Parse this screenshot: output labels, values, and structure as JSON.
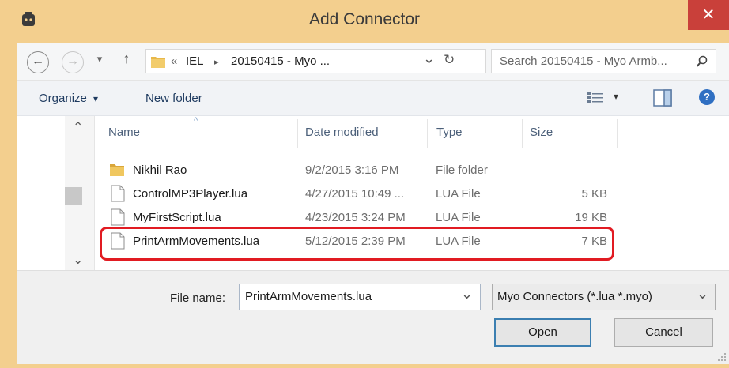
{
  "window": {
    "title": "Add Connector",
    "close_glyph": "✕"
  },
  "nav": {
    "back_glyph": "←",
    "forward_glyph": "→",
    "recent_glyph": "▾",
    "up_glyph": "↑",
    "breadcrumb_prefix": "«",
    "breadcrumb": [
      "IEL",
      "20150415 - Myo ..."
    ],
    "breadcrumb_sep": "▸",
    "dropdown_glyph": "⌄",
    "refresh_glyph": "↻",
    "search_placeholder": "Search 20150415 - Myo Armb...",
    "search_glyph": "⚲"
  },
  "toolbar": {
    "organize_label": "Organize",
    "organize_arrow": "▾",
    "new_folder_label": "New folder",
    "view_arrow": "▾",
    "help_glyph": "?"
  },
  "navpane": {
    "up_arrow": "⌃",
    "down_arrow": "⌄"
  },
  "columns": {
    "name": "Name",
    "date_modified": "Date modified",
    "type": "Type",
    "size": "Size",
    "sort_glyph": "^"
  },
  "files": [
    {
      "name": "Nikhil Rao",
      "date": "9/2/2015 3:16 PM",
      "type": "File folder",
      "size": "",
      "icon": "folder-icon"
    },
    {
      "name": "ControlMP3Player.lua",
      "date": "4/27/2015 10:49 ...",
      "type": "LUA File",
      "size": "5 KB",
      "icon": "file-icon"
    },
    {
      "name": "MyFirstScript.lua",
      "date": "4/23/2015 3:24 PM",
      "type": "LUA File",
      "size": "19 KB",
      "icon": "file-icon"
    },
    {
      "name": "PrintArmMovements.lua",
      "date": "5/12/2015 2:39 PM",
      "type": "LUA File",
      "size": "7 KB",
      "icon": "file-icon"
    }
  ],
  "bottom": {
    "filename_label": "File name:",
    "filename_value": "PrintArmMovements.lua",
    "filename_arrow": "⌄",
    "filetype_value": "Myo Connectors (*.lua *.myo)",
    "filetype_arrow": "⌄",
    "open_label": "Open",
    "cancel_label": "Cancel"
  },
  "colors": {
    "frame": "#f3cf8e",
    "close": "#c9403a",
    "highlight": "#e11b22",
    "folder": "#e8b84a"
  }
}
